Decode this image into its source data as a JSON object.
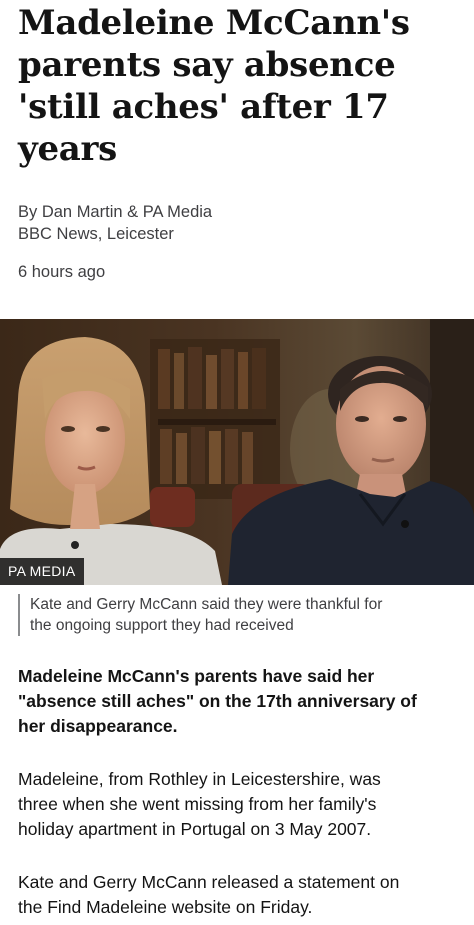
{
  "article": {
    "headline_lines": [
      "Madeleine McCann's",
      "parents say absence",
      "'still aches' after 17",
      "years"
    ],
    "byline": "By Dan Martin & PA Media",
    "location": "BBC News, Leicester",
    "timestamp": "6 hours ago",
    "image": {
      "credit": "PA MEDIA",
      "caption_lines": [
        "Kate and Gerry McCann said they were thankful for",
        "the ongoing support they had received"
      ]
    },
    "lead_lines": [
      "Madeleine McCann's parents have said her",
      "\"absence still aches\" on the 17th anniversary of",
      "her disappearance."
    ],
    "paragraph1_lines": [
      "Madeleine, from Rothley in Leicestershire, was",
      "three when she went missing from her family's",
      "holiday apartment in Portugal on 3 May 2007."
    ],
    "paragraph2_lines": [
      "Kate and Gerry McCann released a statement on",
      "the Find Madeleine website on Friday."
    ]
  },
  "colors": {
    "text": "#141414",
    "meta_text": "#3f3f42",
    "caption_rule": "#8a8c8e",
    "credit_bg": "#000000"
  }
}
